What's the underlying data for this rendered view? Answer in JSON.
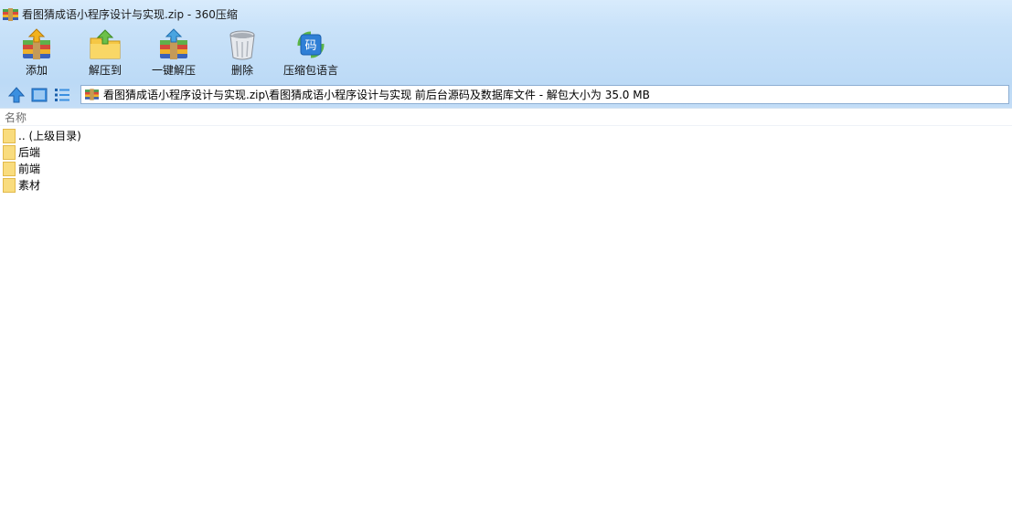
{
  "window": {
    "title": "看图猜成语小程序设计与实现.zip - 360压缩"
  },
  "toolbar": {
    "buttons": [
      {
        "label": "添加",
        "icon": "add-archive-icon"
      },
      {
        "label": "解压到",
        "icon": "extract-to-icon"
      },
      {
        "label": "一键解压",
        "icon": "one-click-extract-icon"
      },
      {
        "label": "删除",
        "icon": "trash-bin-icon"
      },
      {
        "label": "压缩包语言",
        "icon": "encoding-icon",
        "icon_text": "码"
      }
    ]
  },
  "address": {
    "path": "看图猜成语小程序设计与实现.zip\\看图猜成语小程序设计与实现 前后台源码及数据库文件 - 解包大小为 35.0 MB"
  },
  "list": {
    "column_name": "名称",
    "items": [
      {
        "name": ".. (上级目录)",
        "icon": "folder-icon"
      },
      {
        "name": "后端",
        "icon": "folder-icon"
      },
      {
        "name": "前端",
        "icon": "folder-icon"
      },
      {
        "name": "素材",
        "icon": "folder-icon"
      }
    ]
  },
  "colors": {
    "chrome_top": "#d8ebfc",
    "chrome_bottom": "#bcdaf6",
    "folder_yellow": "#f7d774",
    "accent_blue": "#2b7bd6"
  }
}
